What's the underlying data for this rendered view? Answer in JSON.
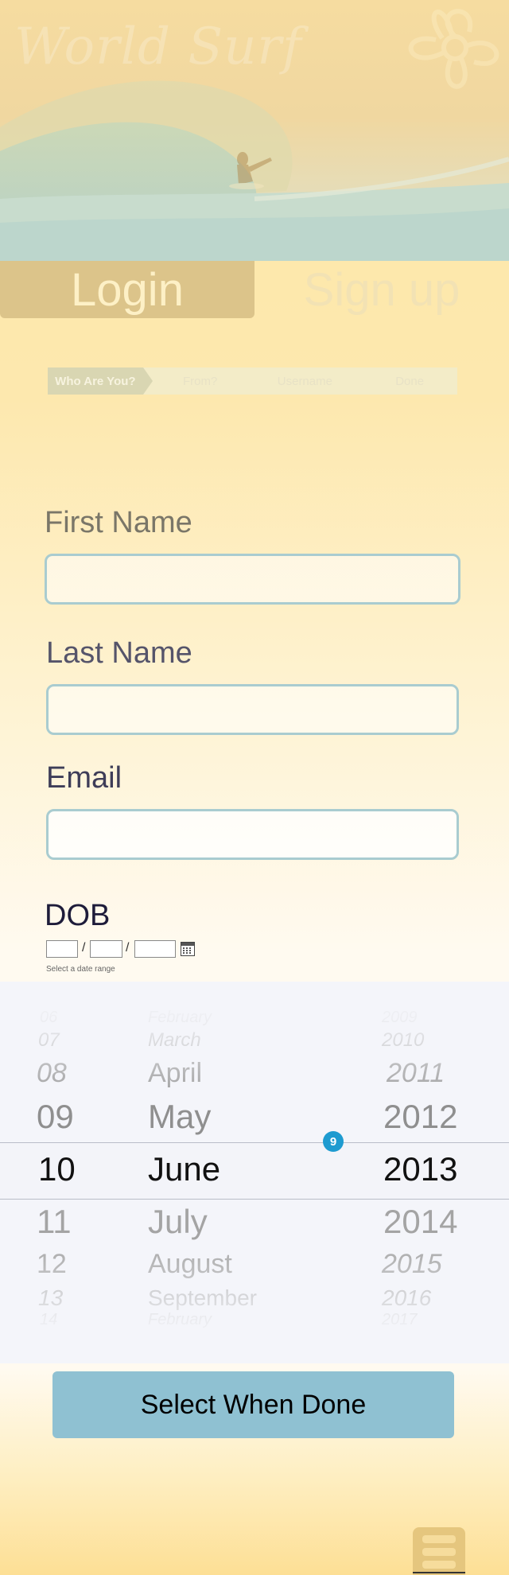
{
  "hero": {
    "logo": "World Surf",
    "icon": "hibiscus-icon"
  },
  "tabs": {
    "login": "Login",
    "signup": "Sign up"
  },
  "stepper": {
    "steps": [
      "Who Are You?",
      "From?",
      "Username",
      "Done"
    ],
    "active_step": 1
  },
  "form": {
    "first_name_label": "First Name",
    "last_name_label": "Last Name",
    "email_label": "Email",
    "dob_label": "DOB",
    "dob_separator": "/",
    "dob_hint": "Select a date range",
    "calendar_icon": "calendar-icon"
  },
  "picker": {
    "rows": [
      {
        "day": "06",
        "month": "February",
        "year": "2009"
      },
      {
        "day": "07",
        "month": "March",
        "year": "2010"
      },
      {
        "day": "08",
        "month": "April",
        "year": "2011"
      },
      {
        "day": "09",
        "month": "May",
        "year": "2012"
      },
      {
        "day": "10",
        "month": "June",
        "year": "2013"
      },
      {
        "day": "11",
        "month": "July",
        "year": "2014"
      },
      {
        "day": "12",
        "month": "August",
        "year": "2015"
      },
      {
        "day": "13",
        "month": "September",
        "year": "2016"
      },
      {
        "day": "14",
        "month": "February",
        "year": "2017"
      }
    ],
    "badge": "9"
  },
  "done_button": "Select When Done",
  "menu_icon": "menu-icon",
  "colors": {
    "accent": "#8fc1d2",
    "badge": "#1e9bd0",
    "input_border": "#a9ccd0"
  }
}
